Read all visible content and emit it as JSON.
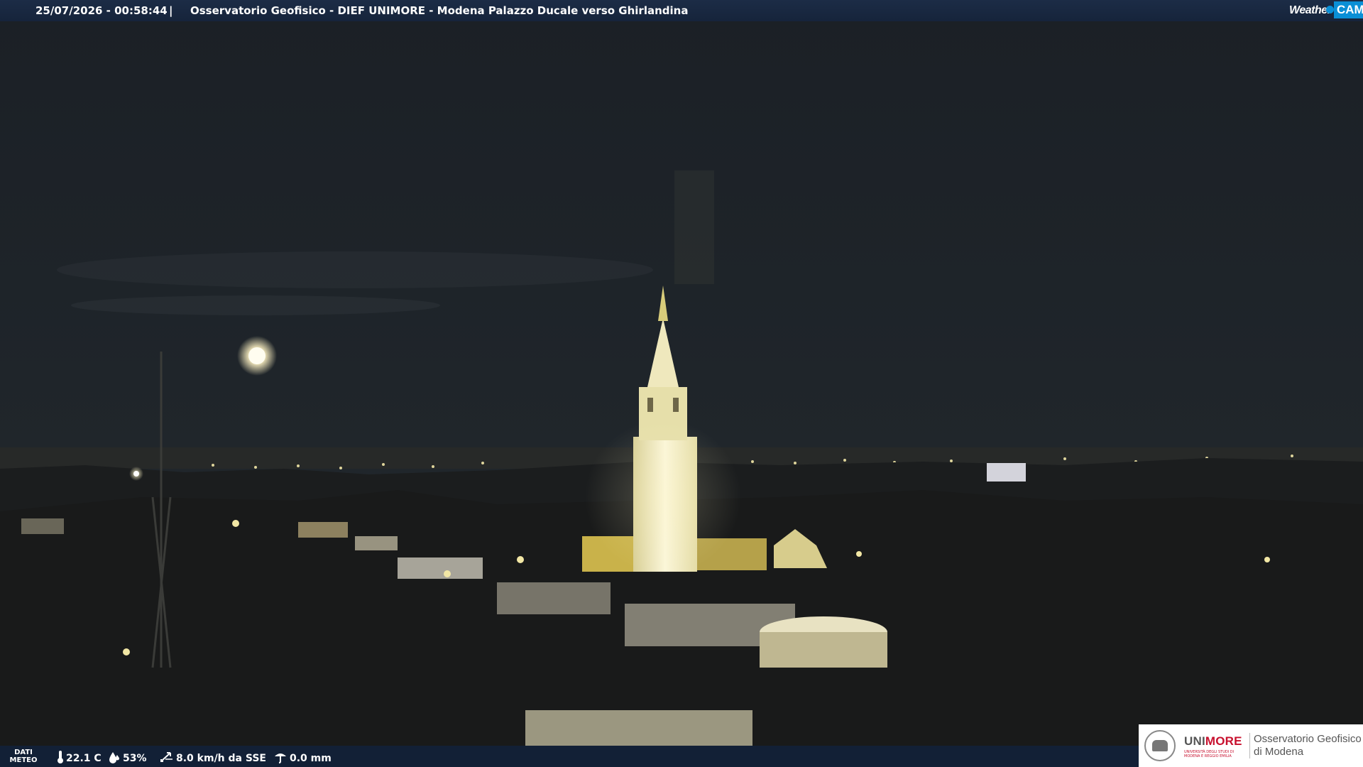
{
  "header": {
    "timestamp": "25/07/2026 - 00:58:44",
    "separator": "|",
    "title": "Osservatorio Geofisico - DIEF UNIMORE - Modena Palazzo Ducale verso Ghirlandina"
  },
  "brand": {
    "weather": "Weather",
    "cam": "CAM",
    "accent": "#0a8fd6"
  },
  "meteo": {
    "label_line1": "DATI",
    "label_line2": "METEO",
    "temperature": "22.1 C",
    "humidity": "53%",
    "wind": "8.0 km/h da SSE",
    "rain": "0.0 mm",
    "icons": [
      "thermometer-icon",
      "humidity-drop-icon",
      "wind-icon",
      "rain-gauge-icon"
    ]
  },
  "institution": {
    "uni": "UNI",
    "more": "MORE",
    "uni_subtitle": "UNIVERSITÀ DEGLI STUDI DI MODENA E REGGIO EMILIA",
    "observatory_line1": "Osservatorio Geofisico",
    "observatory_line2": "di Modena",
    "brand_red": "#c8102e"
  },
  "scene": {
    "description_colors": {
      "sky": "#1c2127",
      "city": "#1a1c1c",
      "lit_tower": "#f3ecc1"
    }
  }
}
